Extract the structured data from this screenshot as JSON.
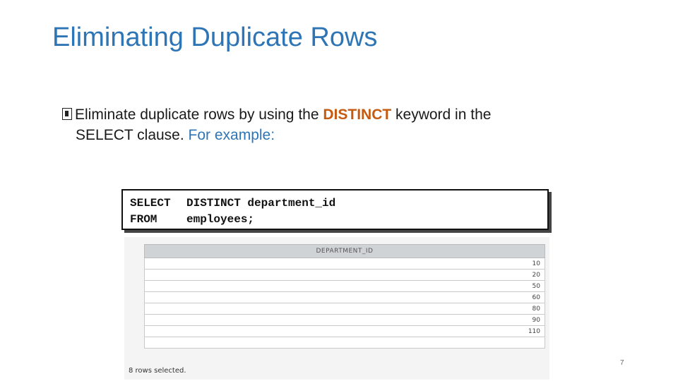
{
  "slide": {
    "title": "Eliminating Duplicate Rows",
    "page_number": "7"
  },
  "bullet": {
    "icon": "bullet-square-icon",
    "text_before": "Eliminate duplicate rows by using the ",
    "keyword": "DISTINCT",
    "text_after_line1": " keyword in the",
    "line2_text": "SELECT clause. ",
    "example_text": "For example:",
    "colors": {
      "keyword": "#c55a11",
      "example": "#2e75b6",
      "title": "#2e75b6"
    }
  },
  "query": {
    "line1_keyword": "SELECT",
    "line1_rest": "DISTINCT department_id",
    "line2_keyword": "FROM",
    "line2_rest": "employees;"
  },
  "result": {
    "column_header": "DEPARTMENT_ID",
    "rows": [
      "10",
      "20",
      "50",
      "60",
      "80",
      "90",
      "110",
      ""
    ],
    "status": "8 rows selected."
  }
}
